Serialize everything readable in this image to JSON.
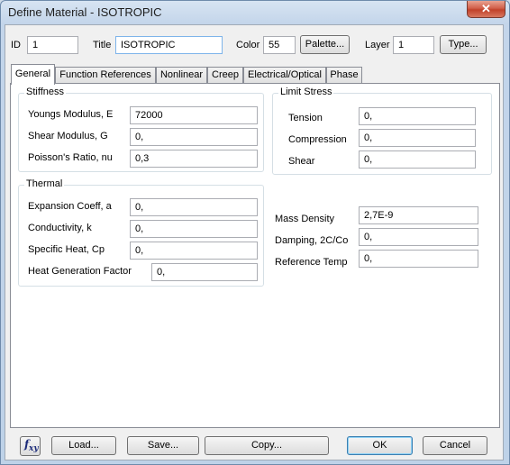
{
  "window": {
    "title": "Define Material - ISOTROPIC",
    "close_glyph": "✕"
  },
  "header": {
    "id_label": "ID",
    "id_value": "1",
    "title_label": "Title",
    "title_value": "ISOTROPIC",
    "color_label": "Color",
    "color_value": "55",
    "palette_button": "Palette...",
    "layer_label": "Layer",
    "layer_value": "1",
    "type_button": "Type..."
  },
  "tabs": [
    "General",
    "Function References",
    "Nonlinear",
    "Creep",
    "Electrical/Optical",
    "Phase"
  ],
  "stiffness": {
    "title": "Stiffness",
    "fields": [
      {
        "label": "Youngs Modulus, E",
        "value": "72000"
      },
      {
        "label": "Shear Modulus, G",
        "value": "0,"
      },
      {
        "label": "Poisson's Ratio, nu",
        "value": "0,3"
      }
    ]
  },
  "limit_stress": {
    "title": "Limit Stress",
    "fields": [
      {
        "label": "Tension",
        "value": "0,"
      },
      {
        "label": "Compression",
        "value": "0,"
      },
      {
        "label": "Shear",
        "value": "0,"
      }
    ]
  },
  "thermal": {
    "title": "Thermal",
    "fields": [
      {
        "label": "Expansion Coeff, a",
        "value": "0,"
      },
      {
        "label": "Conductivity, k",
        "value": "0,"
      },
      {
        "label": "Specific Heat, Cp",
        "value": "0,"
      },
      {
        "label": "Heat Generation Factor",
        "value": "0,"
      }
    ]
  },
  "other": {
    "fields": [
      {
        "label": "Mass Density",
        "value": "2,7E-9"
      },
      {
        "label": "Damping, 2C/Co",
        "value": "0,"
      },
      {
        "label": "Reference Temp",
        "value": "0,"
      }
    ]
  },
  "footer": {
    "fxy_f": "f",
    "fxy_sub": "xy",
    "load": "Load...",
    "save": "Save...",
    "copy": "Copy...",
    "ok": "OK",
    "cancel": "Cancel"
  }
}
